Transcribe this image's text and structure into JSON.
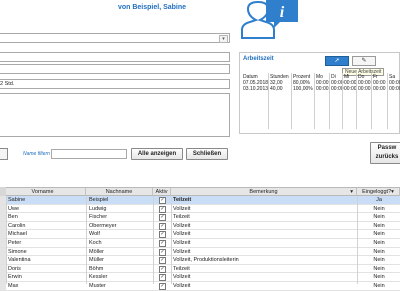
{
  "header": {
    "title": "von Beispiel, Sabine"
  },
  "form": {
    "field_hours_value": "2 Std."
  },
  "arbeitszeit": {
    "title": "Arbeitszeit",
    "add_button_icon": "pin-icon",
    "edit_button_icon": "pencil-icon",
    "tooltip": "Neue Arbeitszeit",
    "columns": [
      "Datum",
      "Stunden",
      "Prozent",
      "Mo",
      "Di",
      "Mi",
      "Do",
      "Fr",
      "Sa"
    ],
    "rows": [
      [
        "07.05.2018",
        "32,00",
        "80,00%",
        "00:00",
        "00:00",
        "00:00",
        "00:00",
        "00:00",
        "00:00"
      ],
      [
        "03.10.2013",
        "40,00",
        "100,00%",
        "00:00",
        "00:00",
        "00:00",
        "00:00",
        "00:00",
        "00:00"
      ]
    ]
  },
  "search": {
    "filter_label": "Name filtern",
    "filter_value": "",
    "show_all_label": "Alle anzeigen",
    "close_label": "Schließen",
    "password_label_1": "Passw",
    "password_label_2": "zurücks"
  },
  "grid": {
    "columns": [
      "Vorname",
      "Nachname",
      "Aktiv",
      "Bemerkung",
      "Eingeloggt?"
    ],
    "rows": [
      {
        "vorname": "Sabine",
        "nachname": "Beispiel",
        "aktiv": true,
        "bemerkung": "Teilzeit",
        "eingeloggt": "Ja",
        "selected": true
      },
      {
        "vorname": "Uwe",
        "nachname": "Ludwig",
        "aktiv": true,
        "bemerkung": "Vollzeit",
        "eingeloggt": "Nein",
        "selected": false
      },
      {
        "vorname": "Ben",
        "nachname": "Fischer",
        "aktiv": true,
        "bemerkung": "Teilzeit",
        "eingeloggt": "Nein",
        "selected": false
      },
      {
        "vorname": "Carolin",
        "nachname": "Obermeyer",
        "aktiv": true,
        "bemerkung": "Vollzeit",
        "eingeloggt": "Nein",
        "selected": false
      },
      {
        "vorname": "Michael",
        "nachname": "Wolf",
        "aktiv": true,
        "bemerkung": "Vollzeit",
        "eingeloggt": "Nein",
        "selected": false
      },
      {
        "vorname": "Peter",
        "nachname": "Koch",
        "aktiv": true,
        "bemerkung": "Vollzeit",
        "eingeloggt": "Nein",
        "selected": false
      },
      {
        "vorname": "Simone",
        "nachname": "Möller",
        "aktiv": true,
        "bemerkung": "Vollzeit",
        "eingeloggt": "Nein",
        "selected": false
      },
      {
        "vorname": "Valentina",
        "nachname": "Müller",
        "aktiv": true,
        "bemerkung": "Vollzeit, Produktionsleiterin",
        "eingeloggt": "Nein",
        "selected": false
      },
      {
        "vorname": "Doris",
        "nachname": "Böhm",
        "aktiv": true,
        "bemerkung": "Teilzeit",
        "eingeloggt": "Nein",
        "selected": false
      },
      {
        "vorname": "Erwin",
        "nachname": "Kessler",
        "aktiv": true,
        "bemerkung": "Vollzeit",
        "eingeloggt": "Nein",
        "selected": false
      },
      {
        "vorname": "Max",
        "nachname": "Muster",
        "aktiv": true,
        "bemerkung": "Vollzeit",
        "eingeloggt": "Nein",
        "selected": false
      }
    ]
  },
  "colors": {
    "accent": "#1f6fbf",
    "selection": "#c9ddf6",
    "button_blue": "#2f7fcc"
  }
}
